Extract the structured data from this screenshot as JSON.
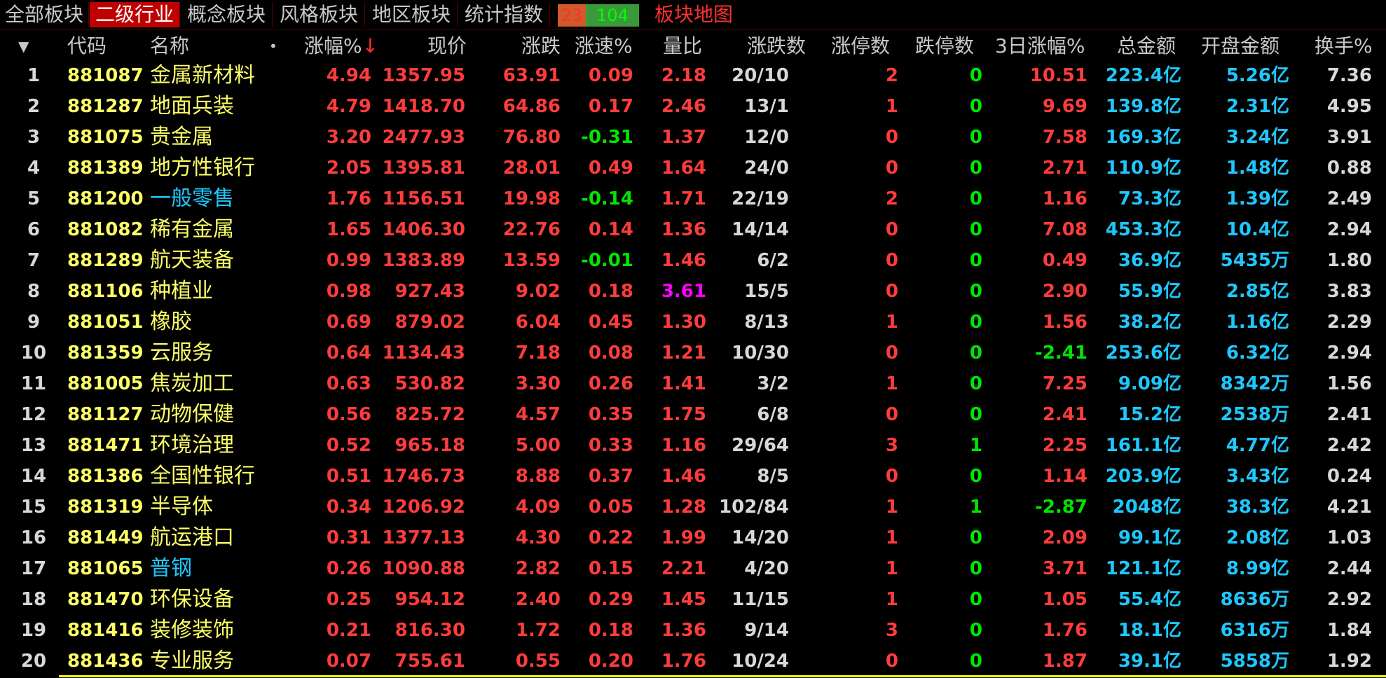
{
  "tabs": [
    {
      "label": "全部板块",
      "active": false
    },
    {
      "label": "二级行业",
      "active": true
    },
    {
      "label": "概念板块",
      "active": false
    },
    {
      "label": "风格板块",
      "active": false
    },
    {
      "label": "地区板块",
      "active": false
    },
    {
      "label": "统计指数",
      "active": false
    }
  ],
  "updown": {
    "up": "23",
    "down": "104"
  },
  "map_link": "板块地图",
  "columns": {
    "menu": "▼",
    "code": "代码",
    "name": "名称",
    "dot": "•",
    "pct": "涨幅%",
    "sort_arrow": "↓",
    "price": "现价",
    "change": "涨跌",
    "speed": "涨速%",
    "vol_ratio": "量比",
    "updown_count": "涨跌数",
    "limit_up": "涨停数",
    "limit_down": "跌停数",
    "pct3d": "3日涨幅%",
    "amount": "总金额",
    "open_amount": "开盘金额",
    "turnover": "换手%"
  },
  "rows": [
    {
      "idx": "1",
      "code": "881087",
      "name": "金属新材料",
      "name_color": "yellow",
      "pct": "4.94",
      "price": "1357.95",
      "change": "63.91",
      "speed": "0.09",
      "speed_color": "red",
      "vol_ratio": "2.18",
      "vol_color": "red",
      "updown": "20/10",
      "limit_up": "2",
      "limit_down": "0",
      "pct3d": "10.51",
      "pct3d_color": "red",
      "amount": "223.4亿",
      "open_amount": "5.26亿",
      "turnover": "7.36"
    },
    {
      "idx": "2",
      "code": "881287",
      "name": "地面兵装",
      "name_color": "yellow",
      "pct": "4.79",
      "price": "1418.70",
      "change": "64.86",
      "speed": "0.17",
      "speed_color": "red",
      "vol_ratio": "2.46",
      "vol_color": "red",
      "updown": "13/1",
      "limit_up": "1",
      "limit_down": "0",
      "pct3d": "9.69",
      "pct3d_color": "red",
      "amount": "139.8亿",
      "open_amount": "2.31亿",
      "turnover": "4.95"
    },
    {
      "idx": "3",
      "code": "881075",
      "name": "贵金属",
      "name_color": "yellow",
      "pct": "3.20",
      "price": "2477.93",
      "change": "76.80",
      "speed": "-0.31",
      "speed_color": "green",
      "vol_ratio": "1.37",
      "vol_color": "red",
      "updown": "12/0",
      "limit_up": "0",
      "limit_down": "0",
      "pct3d": "7.58",
      "pct3d_color": "red",
      "amount": "169.3亿",
      "open_amount": "3.24亿",
      "turnover": "3.91"
    },
    {
      "idx": "4",
      "code": "881389",
      "name": "地方性银行",
      "name_color": "yellow",
      "pct": "2.05",
      "price": "1395.81",
      "change": "28.01",
      "speed": "0.49",
      "speed_color": "red",
      "vol_ratio": "1.64",
      "vol_color": "red",
      "updown": "24/0",
      "limit_up": "0",
      "limit_down": "0",
      "pct3d": "2.71",
      "pct3d_color": "red",
      "amount": "110.9亿",
      "open_amount": "1.48亿",
      "turnover": "0.88"
    },
    {
      "idx": "5",
      "code": "881200",
      "name": "一般零售",
      "name_color": "cyan",
      "pct": "1.76",
      "price": "1156.51",
      "change": "19.98",
      "speed": "-0.14",
      "speed_color": "green",
      "vol_ratio": "1.71",
      "vol_color": "red",
      "updown": "22/19",
      "limit_up": "2",
      "limit_down": "0",
      "pct3d": "1.16",
      "pct3d_color": "red",
      "amount": "73.3亿",
      "open_amount": "1.39亿",
      "turnover": "2.49"
    },
    {
      "idx": "6",
      "code": "881082",
      "name": "稀有金属",
      "name_color": "yellow",
      "pct": "1.65",
      "price": "1406.30",
      "change": "22.76",
      "speed": "0.14",
      "speed_color": "red",
      "vol_ratio": "1.36",
      "vol_color": "red",
      "updown": "14/14",
      "limit_up": "0",
      "limit_down": "0",
      "pct3d": "7.08",
      "pct3d_color": "red",
      "amount": "453.3亿",
      "open_amount": "10.4亿",
      "turnover": "2.94"
    },
    {
      "idx": "7",
      "code": "881289",
      "name": "航天装备",
      "name_color": "yellow",
      "pct": "0.99",
      "price": "1383.89",
      "change": "13.59",
      "speed": "-0.01",
      "speed_color": "green",
      "vol_ratio": "1.46",
      "vol_color": "red",
      "updown": "6/2",
      "limit_up": "0",
      "limit_down": "0",
      "pct3d": "0.49",
      "pct3d_color": "red",
      "amount": "36.9亿",
      "open_amount": "5435万",
      "turnover": "1.80"
    },
    {
      "idx": "8",
      "code": "881106",
      "name": "种植业",
      "name_color": "yellow",
      "pct": "0.98",
      "price": "927.43",
      "change": "9.02",
      "speed": "0.18",
      "speed_color": "red",
      "vol_ratio": "3.61",
      "vol_color": "magenta",
      "updown": "15/5",
      "limit_up": "0",
      "limit_down": "0",
      "pct3d": "2.90",
      "pct3d_color": "red",
      "amount": "55.9亿",
      "open_amount": "2.85亿",
      "turnover": "3.83"
    },
    {
      "idx": "9",
      "code": "881051",
      "name": "橡胶",
      "name_color": "yellow",
      "pct": "0.69",
      "price": "879.02",
      "change": "6.04",
      "speed": "0.45",
      "speed_color": "red",
      "vol_ratio": "1.30",
      "vol_color": "red",
      "updown": "8/13",
      "limit_up": "1",
      "limit_down": "0",
      "pct3d": "1.56",
      "pct3d_color": "red",
      "amount": "38.2亿",
      "open_amount": "1.16亿",
      "turnover": "2.29"
    },
    {
      "idx": "10",
      "code": "881359",
      "name": "云服务",
      "name_color": "yellow",
      "pct": "0.64",
      "price": "1134.43",
      "change": "7.18",
      "speed": "0.08",
      "speed_color": "red",
      "vol_ratio": "1.21",
      "vol_color": "red",
      "updown": "10/30",
      "limit_up": "0",
      "limit_down": "0",
      "pct3d": "-2.41",
      "pct3d_color": "green",
      "amount": "253.6亿",
      "open_amount": "6.32亿",
      "turnover": "2.94"
    },
    {
      "idx": "11",
      "code": "881005",
      "name": "焦炭加工",
      "name_color": "yellow",
      "pct": "0.63",
      "price": "530.82",
      "change": "3.30",
      "speed": "0.26",
      "speed_color": "red",
      "vol_ratio": "1.41",
      "vol_color": "red",
      "updown": "3/2",
      "limit_up": "1",
      "limit_down": "0",
      "pct3d": "7.25",
      "pct3d_color": "red",
      "amount": "9.09亿",
      "open_amount": "8342万",
      "turnover": "1.56"
    },
    {
      "idx": "12",
      "code": "881127",
      "name": "动物保健",
      "name_color": "yellow",
      "pct": "0.56",
      "price": "825.72",
      "change": "4.57",
      "speed": "0.35",
      "speed_color": "red",
      "vol_ratio": "1.75",
      "vol_color": "red",
      "updown": "6/8",
      "limit_up": "0",
      "limit_down": "0",
      "pct3d": "2.41",
      "pct3d_color": "red",
      "amount": "15.2亿",
      "open_amount": "2538万",
      "turnover": "2.41"
    },
    {
      "idx": "13",
      "code": "881471",
      "name": "环境治理",
      "name_color": "yellow",
      "pct": "0.52",
      "price": "965.18",
      "change": "5.00",
      "speed": "0.33",
      "speed_color": "red",
      "vol_ratio": "1.16",
      "vol_color": "red",
      "updown": "29/64",
      "limit_up": "3",
      "limit_down": "1",
      "pct3d": "2.25",
      "pct3d_color": "red",
      "amount": "161.1亿",
      "open_amount": "4.77亿",
      "turnover": "2.42"
    },
    {
      "idx": "14",
      "code": "881386",
      "name": "全国性银行",
      "name_color": "yellow",
      "pct": "0.51",
      "price": "1746.73",
      "change": "8.88",
      "speed": "0.37",
      "speed_color": "red",
      "vol_ratio": "1.46",
      "vol_color": "red",
      "updown": "8/5",
      "limit_up": "0",
      "limit_down": "0",
      "pct3d": "1.14",
      "pct3d_color": "red",
      "amount": "203.9亿",
      "open_amount": "3.43亿",
      "turnover": "0.24"
    },
    {
      "idx": "15",
      "code": "881319",
      "name": "半导体",
      "name_color": "yellow",
      "pct": "0.34",
      "price": "1206.92",
      "change": "4.09",
      "speed": "0.05",
      "speed_color": "red",
      "vol_ratio": "1.28",
      "vol_color": "red",
      "updown": "102/84",
      "limit_up": "1",
      "limit_down": "1",
      "pct3d": "-2.87",
      "pct3d_color": "green",
      "amount": "2048亿",
      "open_amount": "38.3亿",
      "turnover": "4.21"
    },
    {
      "idx": "16",
      "code": "881449",
      "name": "航运港口",
      "name_color": "yellow",
      "pct": "0.31",
      "price": "1377.13",
      "change": "4.30",
      "speed": "0.22",
      "speed_color": "red",
      "vol_ratio": "1.99",
      "vol_color": "red",
      "updown": "14/20",
      "limit_up": "1",
      "limit_down": "0",
      "pct3d": "2.09",
      "pct3d_color": "red",
      "amount": "99.1亿",
      "open_amount": "2.08亿",
      "turnover": "1.03"
    },
    {
      "idx": "17",
      "code": "881065",
      "name": "普钢",
      "name_color": "cyan",
      "pct": "0.26",
      "price": "1090.88",
      "change": "2.82",
      "speed": "0.15",
      "speed_color": "red",
      "vol_ratio": "2.21",
      "vol_color": "red",
      "updown": "4/20",
      "limit_up": "1",
      "limit_down": "0",
      "pct3d": "3.71",
      "pct3d_color": "red",
      "amount": "121.1亿",
      "open_amount": "8.99亿",
      "turnover": "2.44"
    },
    {
      "idx": "18",
      "code": "881470",
      "name": "环保设备",
      "name_color": "yellow",
      "pct": "0.25",
      "price": "954.12",
      "change": "2.40",
      "speed": "0.29",
      "speed_color": "red",
      "vol_ratio": "1.45",
      "vol_color": "red",
      "updown": "11/15",
      "limit_up": "1",
      "limit_down": "0",
      "pct3d": "1.05",
      "pct3d_color": "red",
      "amount": "55.4亿",
      "open_amount": "8636万",
      "turnover": "2.92"
    },
    {
      "idx": "19",
      "code": "881416",
      "name": "装修装饰",
      "name_color": "yellow",
      "pct": "0.21",
      "price": "816.30",
      "change": "1.72",
      "speed": "0.18",
      "speed_color": "red",
      "vol_ratio": "1.36",
      "vol_color": "red",
      "updown": "9/14",
      "limit_up": "3",
      "limit_down": "0",
      "pct3d": "1.76",
      "pct3d_color": "red",
      "amount": "18.1亿",
      "open_amount": "6316万",
      "turnover": "1.84"
    },
    {
      "idx": "20",
      "code": "881436",
      "name": "专业服务",
      "name_color": "yellow",
      "pct": "0.07",
      "price": "755.61",
      "change": "0.55",
      "speed": "0.20",
      "speed_color": "red",
      "vol_ratio": "1.76",
      "vol_color": "red",
      "updown": "10/24",
      "limit_up": "0",
      "limit_down": "0",
      "pct3d": "1.87",
      "pct3d_color": "red",
      "amount": "39.1亿",
      "open_amount": "5858万",
      "turnover": "1.92"
    }
  ]
}
